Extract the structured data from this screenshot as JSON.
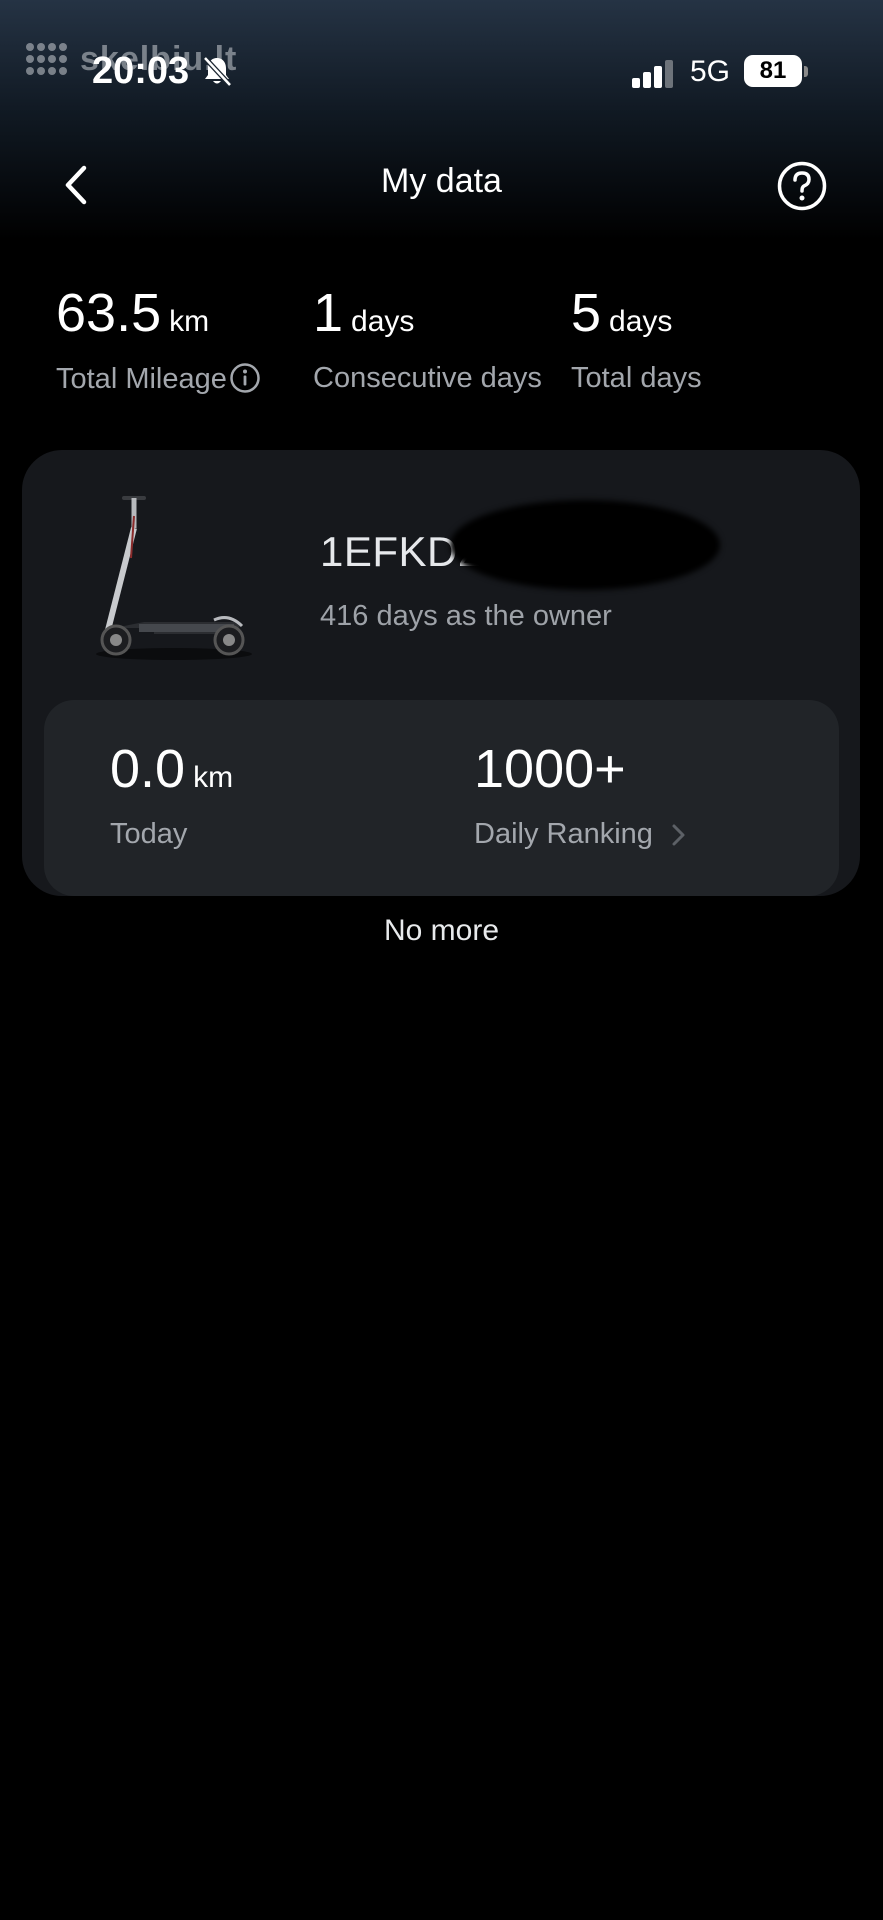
{
  "status_bar": {
    "watermark": "skelbiu.lt",
    "time": "20:03",
    "network": "5G",
    "battery": "81",
    "icons": [
      "bell-off-icon",
      "signal-icon"
    ]
  },
  "header": {
    "title": "My data",
    "back_icon": "chevron-left-icon",
    "help_icon": "question-circle-icon"
  },
  "stats": {
    "total_mileage": {
      "value": "63.5",
      "unit": "km",
      "label": "Total Mileage"
    },
    "consecutive_days": {
      "value": "1",
      "unit": "days",
      "label": "Consecutive days"
    },
    "total_days": {
      "value": "5",
      "unit": "days",
      "label": "Total days"
    }
  },
  "device": {
    "name": "1EFKD2",
    "owner_days": "416 days as the owner",
    "image": "scooter-image",
    "today": {
      "value": "0.0",
      "unit": "km",
      "label": "Today"
    },
    "ranking": {
      "value": "1000+",
      "label": "Daily Ranking"
    }
  },
  "footer": {
    "no_more": "No more"
  },
  "colors": {
    "background": "#000000",
    "card": "#16181c",
    "panel": "#212428",
    "muted_text": "#a3a7ad"
  }
}
